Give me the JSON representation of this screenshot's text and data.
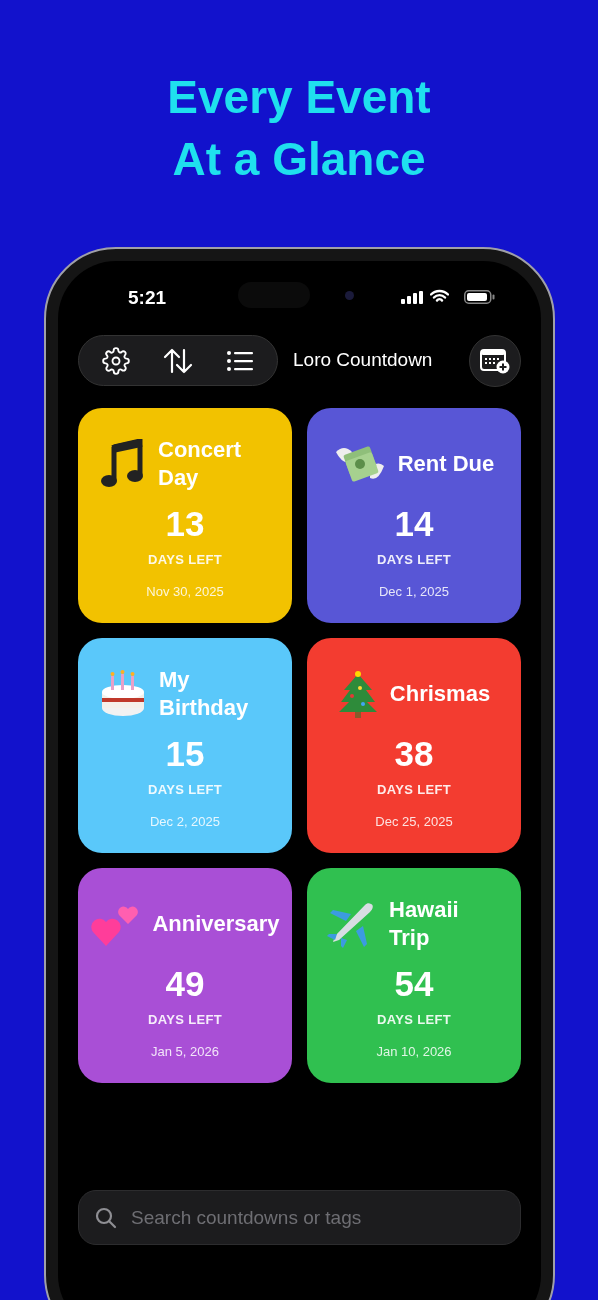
{
  "headline": [
    "Every Event",
    "At a Glance"
  ],
  "status_bar": {
    "time": "5:21"
  },
  "app": {
    "title": "Loro Countdown"
  },
  "events": [
    {
      "title": "Concert Day",
      "days": "13",
      "unit": "DAYS LEFT",
      "date": "Nov 30, 2025",
      "color": "#f2c200"
    },
    {
      "title": "Rent Due",
      "days": "14",
      "unit": "DAYS LEFT",
      "date": "Dec 1, 2025",
      "color": "#5856d6"
    },
    {
      "title": "My Birthday",
      "days": "15",
      "unit": "DAYS LEFT",
      "date": "Dec 2, 2025",
      "color": "#5ac8fa"
    },
    {
      "title": "Chrismas",
      "days": "38",
      "unit": "DAYS LEFT",
      "date": "Dec 25, 2025",
      "color": "#f33c30"
    },
    {
      "title": "Anniversary",
      "days": "49",
      "unit": "DAYS LEFT",
      "date": "Jan 5, 2026",
      "color": "#a94fd6"
    },
    {
      "title": "Hawaii Trip",
      "days": "54",
      "unit": "DAYS LEFT",
      "date": "Jan 10, 2026",
      "color": "#30c050"
    }
  ],
  "search": {
    "placeholder": "Search countdowns or tags"
  }
}
